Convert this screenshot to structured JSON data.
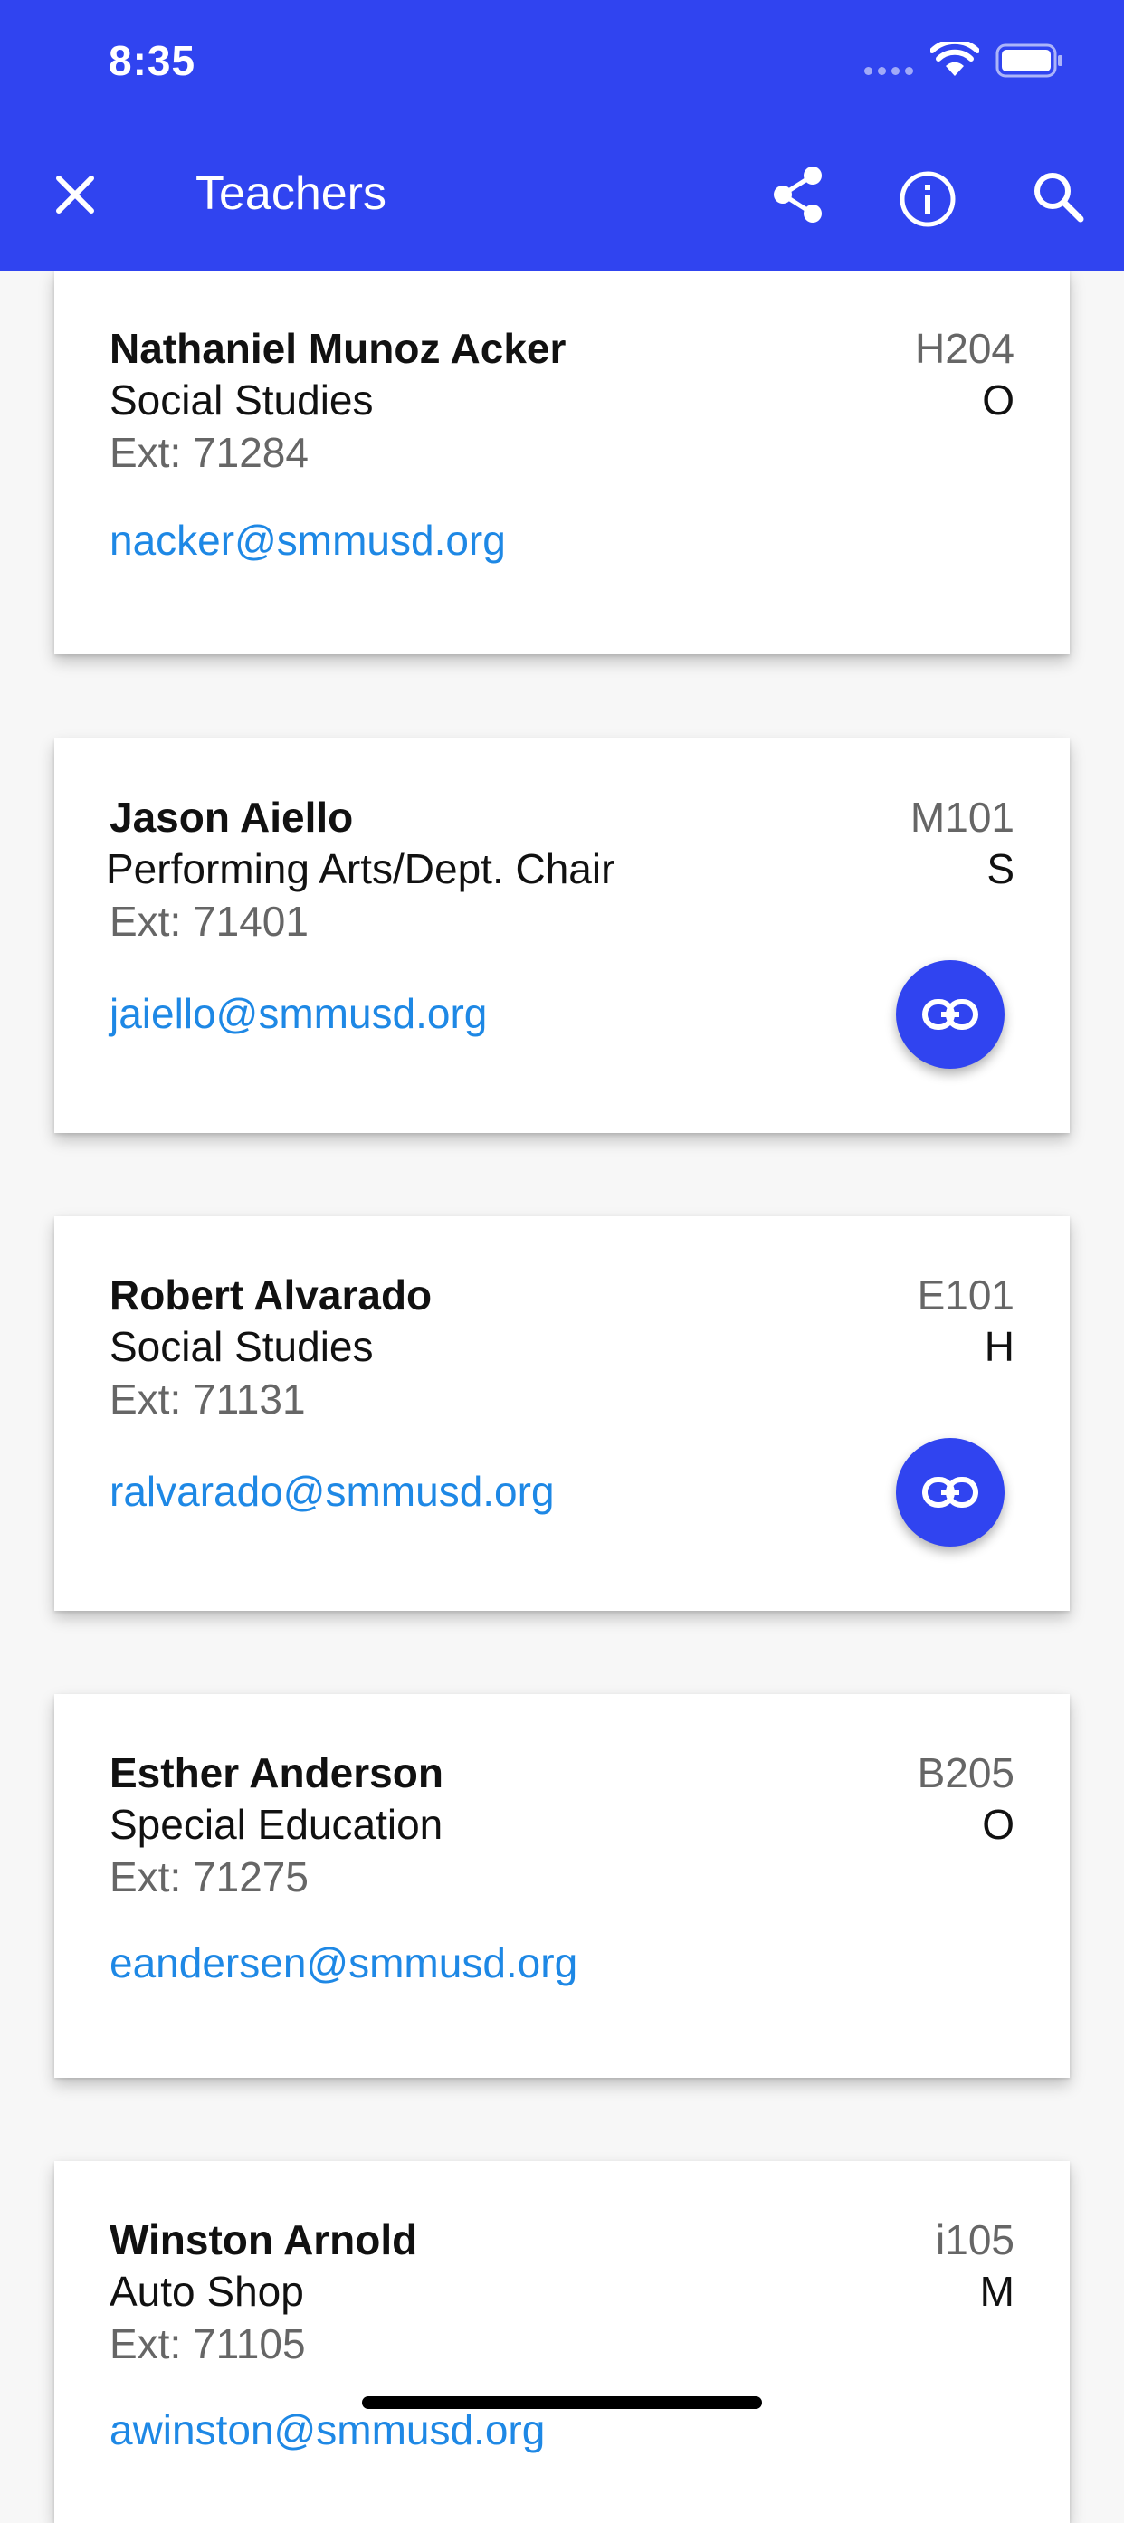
{
  "status_bar": {
    "time": "8:35"
  },
  "header": {
    "title": "Teachers"
  },
  "icons": {
    "close": "close-icon",
    "share": "share-icon",
    "info": "info-icon",
    "search": "search-icon",
    "link": "link-icon"
  },
  "colors": {
    "accent": "#3044f0",
    "email": "#1e88e5"
  },
  "teachers": [
    {
      "name": "Nathaniel Munoz Acker",
      "department": "Social Studies",
      "extension": "Ext: 71284",
      "email": "nacker@smmusd.org",
      "room": "H204",
      "period": "O"
    },
    {
      "name": "Jason Aiello",
      "department": "Performing Arts/Dept. Chair",
      "extension": "Ext: 71401",
      "email": "jaiello@smmusd.org",
      "room": "M101",
      "period": "S"
    },
    {
      "name": "Robert Alvarado",
      "department": "Social Studies",
      "extension": "Ext: 71131",
      "email": "ralvarado@smmusd.org",
      "room": "E101",
      "period": "H"
    },
    {
      "name": "Esther Anderson",
      "department": "Special Education",
      "extension": "Ext: 71275",
      "email": "eandersen@smmusd.org",
      "room": "B205",
      "period": "O"
    },
    {
      "name": "Winston Arnold",
      "department": "Auto Shop",
      "extension": "Ext: 71105",
      "email": "awinston@smmusd.org",
      "room": "i105",
      "period": "M"
    }
  ]
}
